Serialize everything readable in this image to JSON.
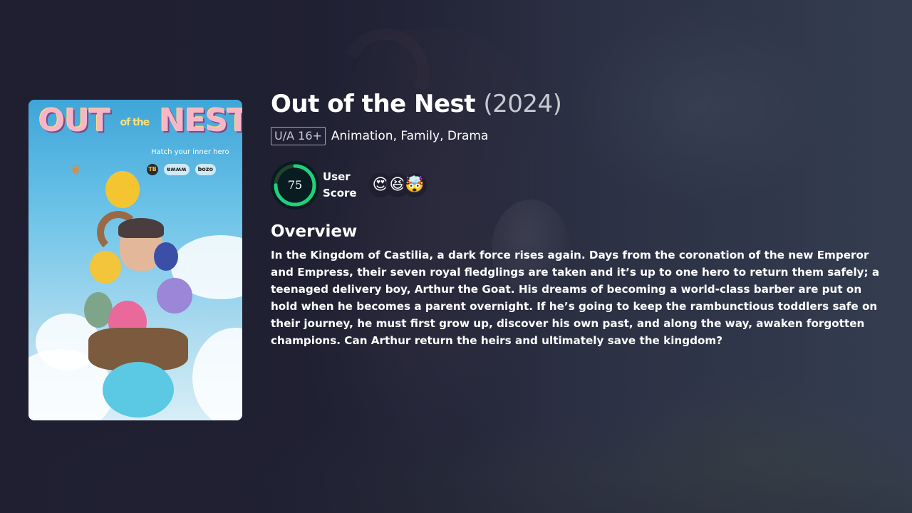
{
  "movie": {
    "title": "Out of the Nest",
    "year": "(2024)",
    "certification": "U/A 16+",
    "genres": "Animation, Family, Drama",
    "user_score": 75,
    "user_score_label": "User Score",
    "reactions": [
      "😍",
      "😆",
      "🤯"
    ],
    "overview_heading": "Overview",
    "overview": "In the Kingdom of Castilia, a dark force rises again. Days from the coronation of the new Emperor and Empress, their seven royal fledglings are taken and it’s up to one hero to return them safely; a teenaged delivery boy, Arthur the Goat. His dreams of becoming a world-class barber are put on hold when he becomes a parent overnight. If he’s going to keep the rambunctious toddlers safe on their journey, he must first grow up, discover his own past, and along the way, awaken forgotten champions. Can Arthur return the heirs and ultimately save the kingdom?"
  },
  "poster": {
    "logo_main": "OUT",
    "logo_of_the": "of the",
    "logo_end": "NEST",
    "tagline": "Hatch your inner hero",
    "badges": [
      "TB",
      "ɐʍʍʍ",
      "bozo"
    ]
  },
  "colors": {
    "background": "#1f1f31",
    "score_ring": "#21d07a",
    "score_track": "#204529"
  }
}
